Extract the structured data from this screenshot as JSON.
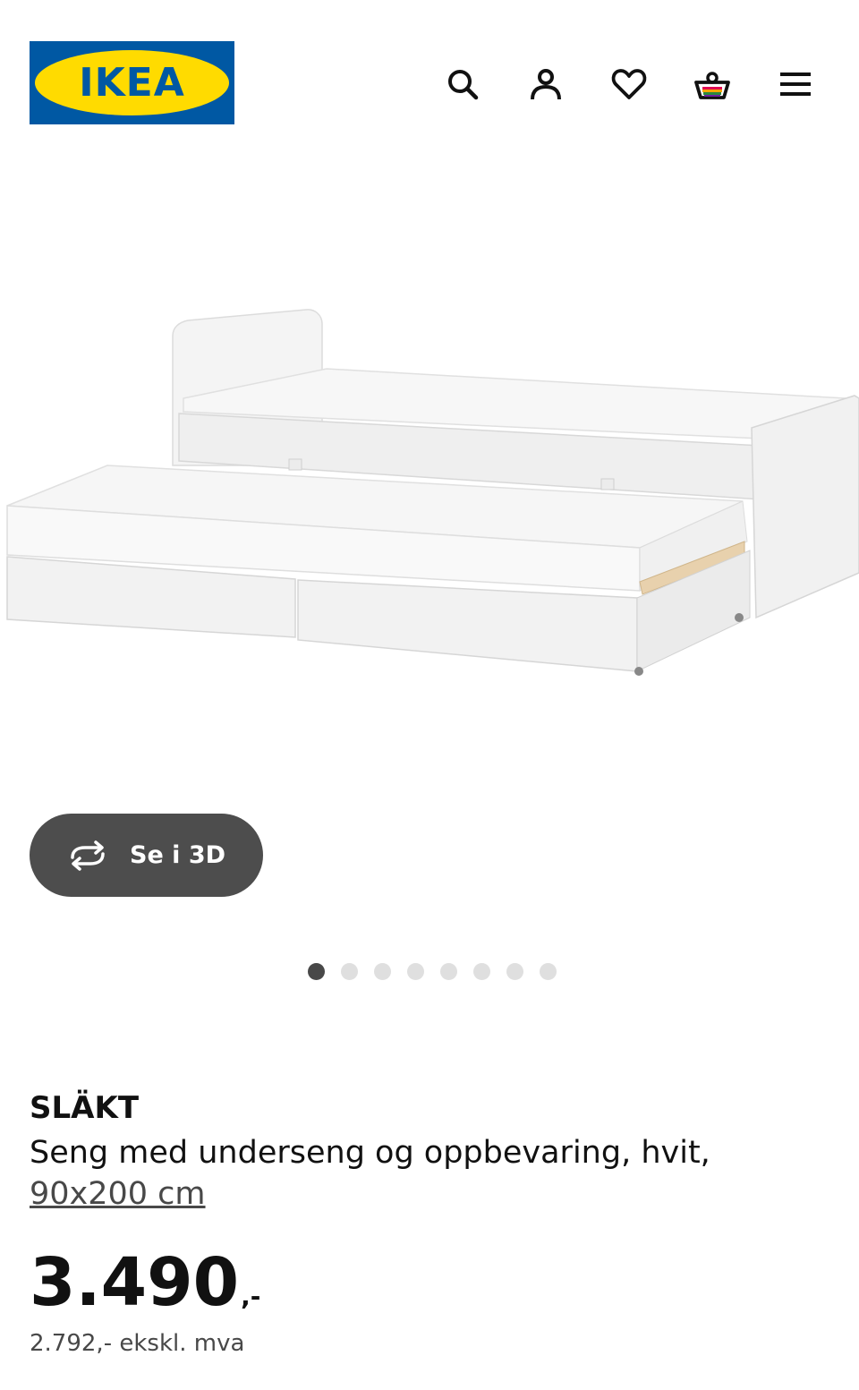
{
  "header": {
    "logo_text": "IKEA",
    "logo_reg": "®",
    "icons": [
      "search-icon",
      "account-icon",
      "heart-icon",
      "basket-icon",
      "menu-icon"
    ],
    "colors": {
      "logo_blue": "#0058a3",
      "logo_yellow": "#ffdb00"
    }
  },
  "gallery": {
    "view_3d_label": "Se i 3D",
    "dots_total": 8,
    "active_dot": 1
  },
  "product": {
    "name": "SLÄKT",
    "description": "Seng med underseng og oppbevaring, hvit,",
    "size": "90x200 cm",
    "price": "3.490",
    "price_suffix": ",-",
    "price_ex_vat": "2.792,- ekskl. mva"
  }
}
